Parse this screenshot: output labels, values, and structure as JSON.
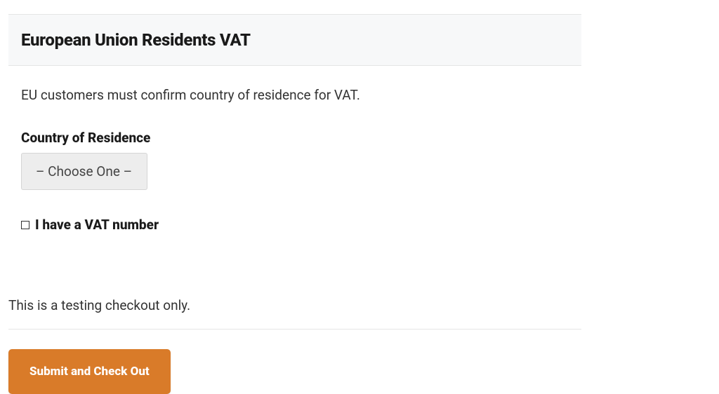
{
  "section": {
    "title": "European Union Residents VAT",
    "description": "EU customers must confirm country of residence for VAT."
  },
  "form": {
    "country_label": "Country of Residence",
    "country_placeholder": "– Choose One –",
    "vat_checkbox_label": "I have a VAT number",
    "vat_checked": false
  },
  "notice": "This is a testing checkout only.",
  "submit_label": "Submit and Check Out"
}
